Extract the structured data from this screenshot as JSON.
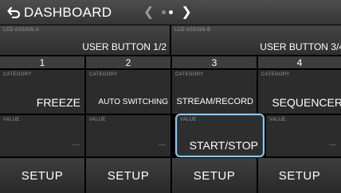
{
  "header": {
    "title": "DASHBOARD"
  },
  "lcd_assign": [
    {
      "caption": "LCD ASSIGN A",
      "value": "USER BUTTON 1/2"
    },
    {
      "caption": "LCD ASSIGN B",
      "value": "USER BUTTON 3/4"
    }
  ],
  "columns": [
    {
      "number": "1",
      "category_caption": "CATEGORY",
      "category": "FREEZE",
      "value_caption": "VALUE",
      "value": "---",
      "setup": "SETUP"
    },
    {
      "number": "2",
      "category_caption": "CATEGORY",
      "category": "AUTO SWITCHING",
      "value_caption": "VALUE",
      "value": "---",
      "setup": "SETUP"
    },
    {
      "number": "3",
      "category_caption": "CATEGORY",
      "category": "STREAM/RECORD",
      "value_caption": "VALUE",
      "value": "START/STOP",
      "setup": "SETUP"
    },
    {
      "number": "4",
      "category_caption": "CATEGORY",
      "category": "SEQUENCER",
      "value_caption": "VALUE",
      "value": "---",
      "setup": "SETUP"
    }
  ],
  "colors": {
    "selection_border": "#8fc7ec",
    "background": "#000000"
  }
}
